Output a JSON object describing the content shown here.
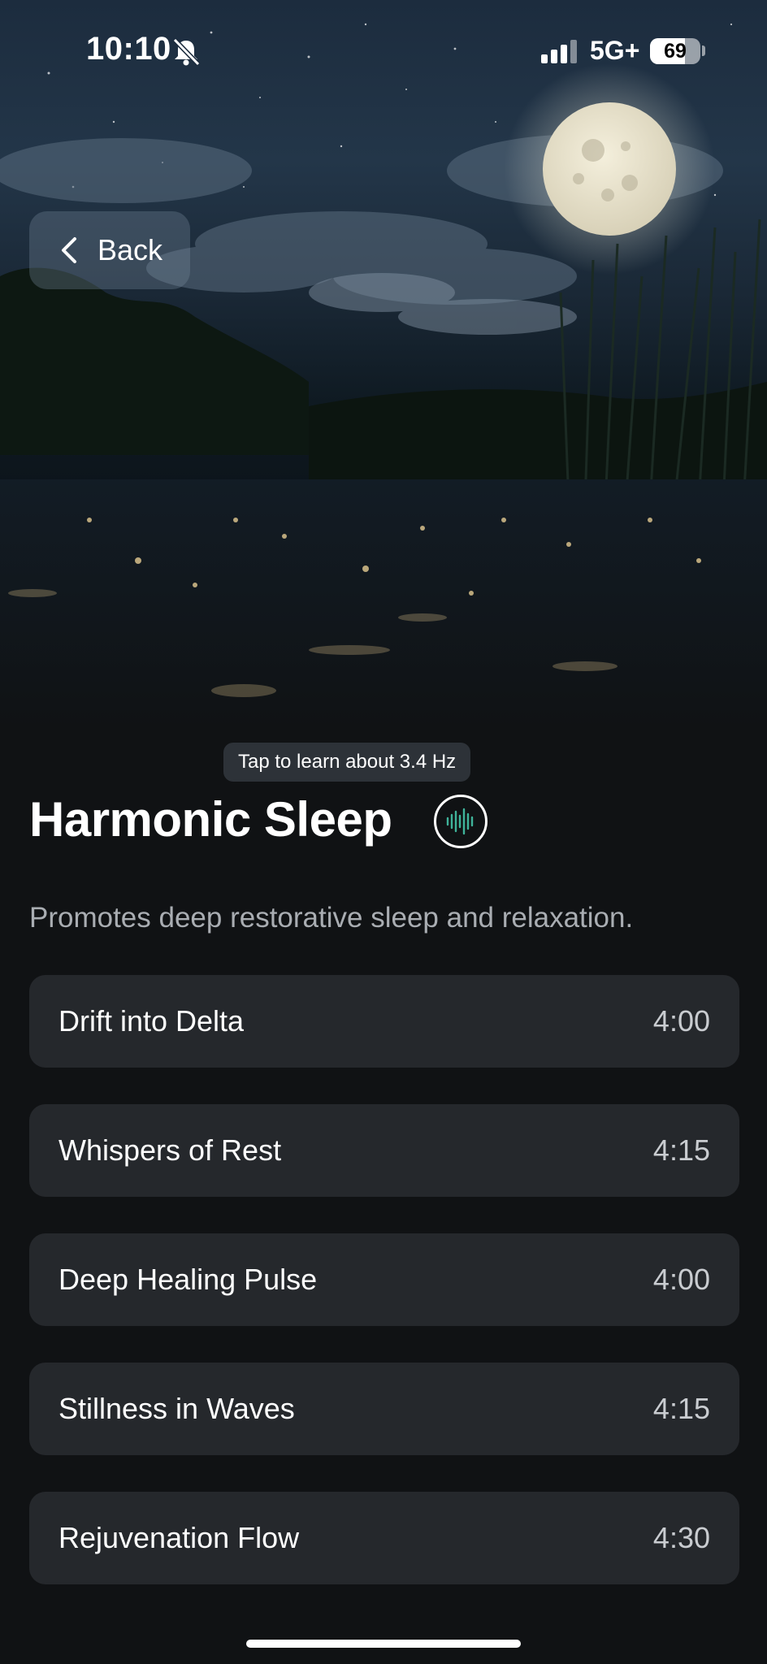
{
  "status_bar": {
    "time": "10:10",
    "network": "5G+",
    "battery": "69",
    "battery_level": 0.69
  },
  "nav": {
    "back_label": "Back"
  },
  "header": {
    "tooltip": "Tap to learn about 3.4 Hz",
    "title": "Harmonic Sleep",
    "description": "Promotes deep restorative sleep and relaxation."
  },
  "tracks": [
    {
      "name": "Drift into Delta",
      "duration": "4:00"
    },
    {
      "name": "Whispers of Rest",
      "duration": "4:15"
    },
    {
      "name": "Deep Healing Pulse",
      "duration": "4:00"
    },
    {
      "name": "Stillness in Waves",
      "duration": "4:15"
    },
    {
      "name": "Rejuvenation Flow",
      "duration": "4:30"
    }
  ],
  "colors": {
    "background": "#101214",
    "card": "#25282c",
    "accent_wave": "#3fb39a"
  }
}
